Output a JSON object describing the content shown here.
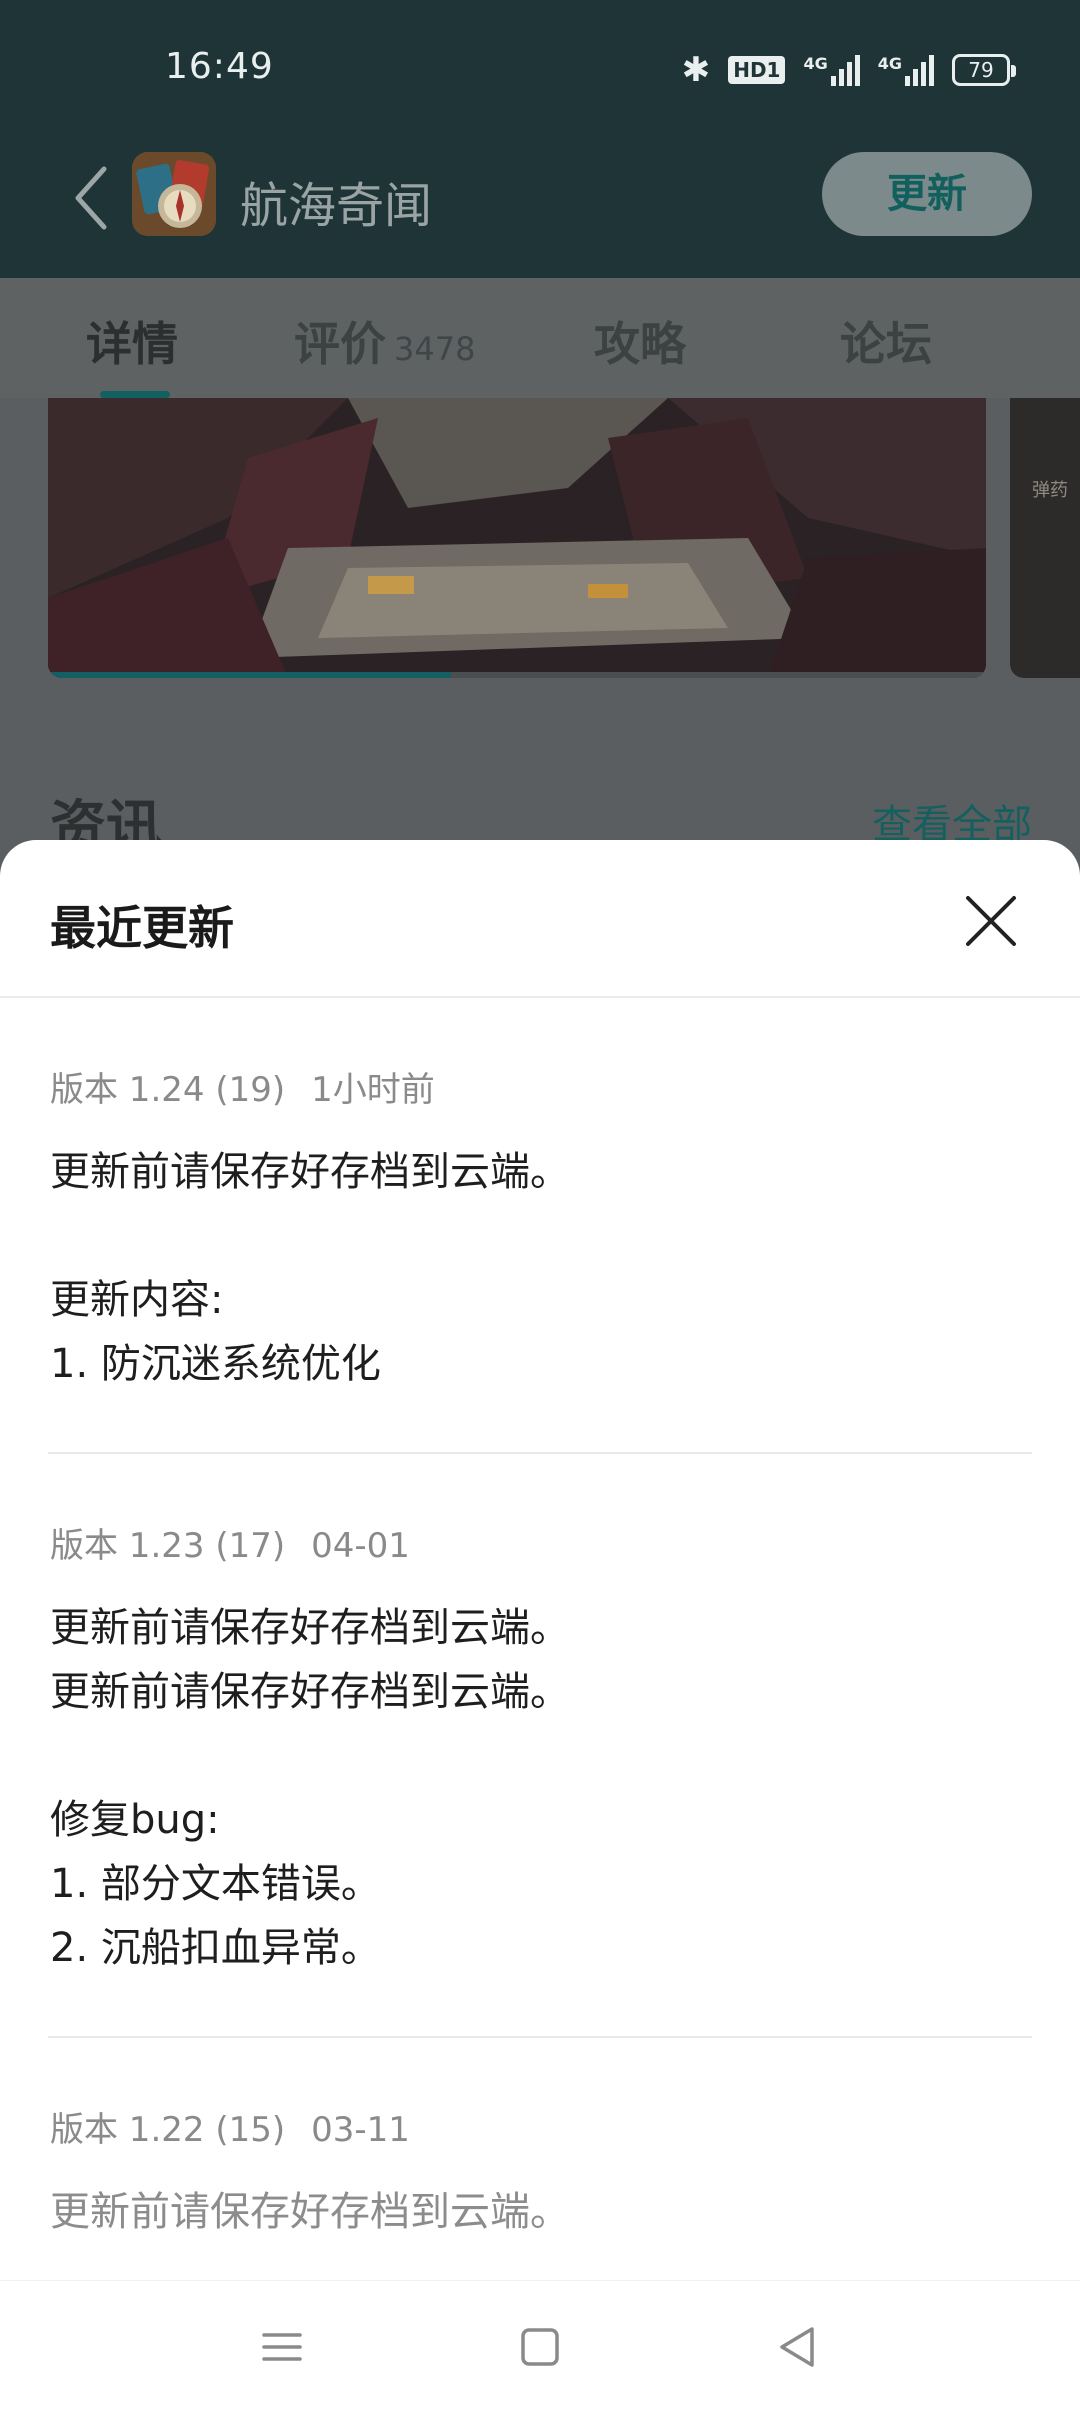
{
  "status_bar": {
    "time": "16:49",
    "bluetooth_icon": "bluetooth-icon",
    "hd_badge": "HD1",
    "signal_1_label": "4G",
    "signal_2_label": "4G",
    "battery": "79"
  },
  "header": {
    "back_icon": "chevron-left-icon",
    "app_name": "航海奇闻",
    "update_label": "更新"
  },
  "tabs": [
    {
      "label": "详情",
      "selected": true
    },
    {
      "label": "评价",
      "count": "3478"
    },
    {
      "label": "攻略"
    },
    {
      "label": "论坛"
    }
  ],
  "banner": {
    "progress": 0.43,
    "side_tag": "弹药"
  },
  "news": {
    "title": "资讯",
    "view_all": "查看全部"
  },
  "sheet": {
    "title": "最近更新",
    "close_icon": "close-icon",
    "entries": [
      {
        "version": "版本 1.24 (19)",
        "time": "1小时前",
        "lines": [
          "更新前请保存好存档到云端。",
          "",
          "更新内容:",
          "1. 防沉迷系统优化"
        ]
      },
      {
        "version": "版本 1.23 (17)",
        "time": "04-01",
        "lines": [
          "更新前请保存好存档到云端。",
          "更新前请保存好存档到云端。",
          "",
          "修复bug:",
          "1. 部分文本错误。",
          "2. 沉船扣血异常。"
        ]
      },
      {
        "version": "版本 1.22 (15)",
        "time": "03-11",
        "lines": [
          "更新前请保存好存档到云端。"
        ]
      }
    ]
  },
  "navbar": {
    "menu_icon": "menu-icon",
    "home_icon": "home-square-icon",
    "back_icon": "back-triangle-icon"
  },
  "colors": {
    "accent": "#15605f",
    "header_dim": "#1f3436",
    "sheet_bg": "#ffffff"
  }
}
